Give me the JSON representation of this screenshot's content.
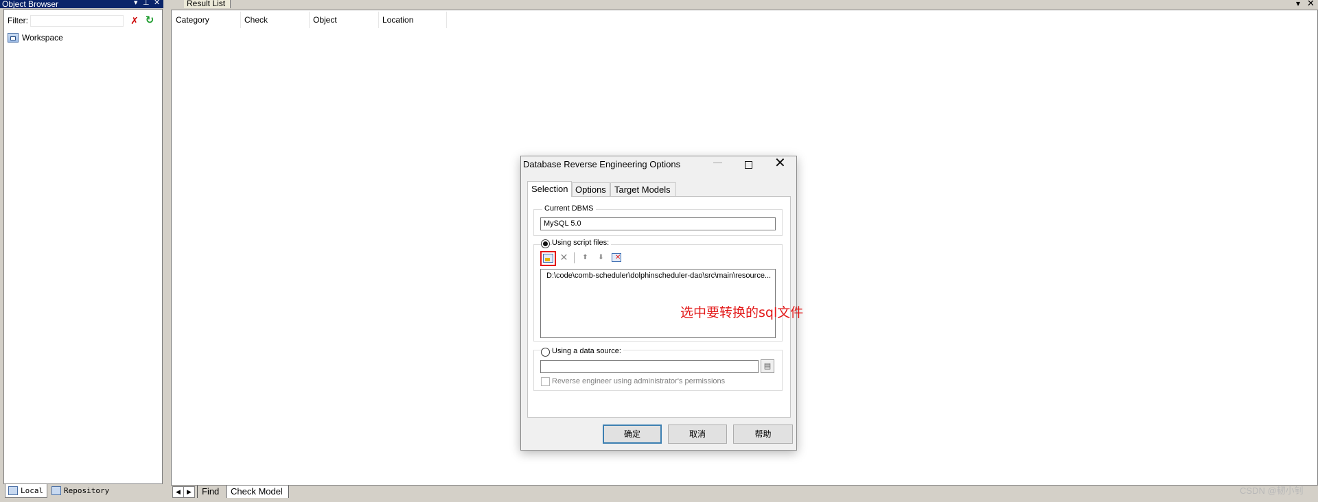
{
  "object_browser": {
    "title": "Object Browser",
    "controls": {
      "menu": "▾",
      "pin": "⊥",
      "close": "✕"
    },
    "filter_label": "Filter:",
    "filter_value": "",
    "tree": [
      {
        "label": "Workspace",
        "icon": "workspace-icon"
      }
    ],
    "tabs": [
      {
        "label": "Local"
      },
      {
        "label": "Repository"
      }
    ]
  },
  "result_list": {
    "title": "Result List",
    "columns": [
      "Category",
      "Check",
      "Object",
      "Location"
    ],
    "tabs": [
      {
        "label": "Find"
      },
      {
        "label": "Check Model"
      }
    ],
    "nav": {
      "left": "◀",
      "right": "▶"
    },
    "menu": "▾",
    "close": "✕"
  },
  "dialog": {
    "title": "Database Reverse Engineering Options",
    "controls": {
      "minimize": "—",
      "close": "✕"
    },
    "tabs": [
      "Selection",
      "Options",
      "Target Models"
    ],
    "active_tab": "Selection",
    "current_dbms_label": "Current DBMS",
    "current_dbms_value": "MySQL 5.0",
    "script_option_label": "Using script files:",
    "script_option_selected": true,
    "script_files": [
      "D:\\code\\comb-scheduler\\dolphinscheduler-dao\\src\\main\\resource..."
    ],
    "toolbar_glyphs": {
      "delete": "✕",
      "up": "⬆",
      "down": "⬇"
    },
    "datasource_option_label": "Using a data source:",
    "datasource_value": "",
    "datasource_browse": "▤",
    "admin_check_label": "Reverse engineer using administrator's permissions",
    "admin_checked": false,
    "buttons": {
      "ok": "确定",
      "cancel": "取消",
      "help": "帮助"
    }
  },
  "annotation": {
    "text": "选中要转换的sql文件",
    "color": "#e31818"
  },
  "watermark": "CSDN @韧小钊",
  "colors": {
    "title_bar": "#0a246a",
    "highlight_box": "#e31818",
    "ok_border": "#3c7fb1"
  }
}
